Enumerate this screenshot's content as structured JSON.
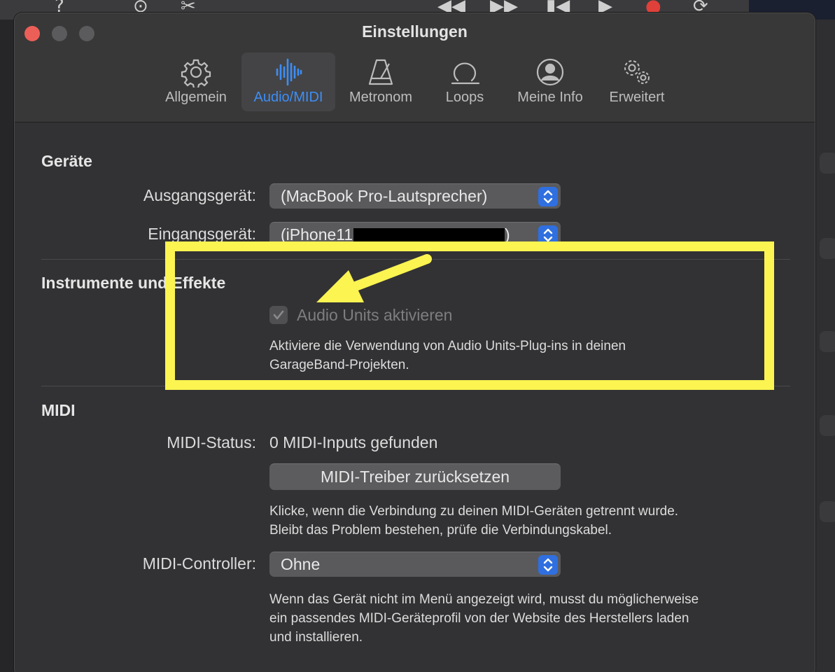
{
  "window": {
    "title": "Einstellungen"
  },
  "tabs": [
    {
      "label": "Allgemein",
      "icon": "gear-icon",
      "active": false
    },
    {
      "label": "Audio/MIDI",
      "icon": "waveform-icon",
      "active": true
    },
    {
      "label": "Metronom",
      "icon": "metronome-icon",
      "active": false
    },
    {
      "label": "Loops",
      "icon": "loop-icon",
      "active": false
    },
    {
      "label": "Meine Info",
      "icon": "person-circle-icon",
      "active": false
    },
    {
      "label": "Erweitert",
      "icon": "gears-icon",
      "active": false
    }
  ],
  "devices": {
    "title": "Geräte",
    "output_label": "Ausgangsgerät:",
    "output_value": "(MacBook Pro-Lautsprecher)",
    "input_label": "Eingangsgerät:",
    "input_value": "(iPhone11",
    "input_value_end": ")"
  },
  "instruments": {
    "title": "Instrumente und Effekte",
    "audio_units_label": "Audio Units aktivieren",
    "audio_units_checked": true,
    "audio_units_desc_1": "Aktiviere die Verwendung von Audio Units-Plug-ins in deinen",
    "audio_units_desc_2": "GarageBand-Projekten."
  },
  "midi": {
    "title": "MIDI",
    "status_label": "MIDI-Status:",
    "status_value": "0 MIDI-Inputs gefunden",
    "reset_button": "MIDI-Treiber zurücksetzen",
    "reset_desc_1": "Klicke, wenn die Verbindung zu deinen MIDI-Geräten getrennt wurde.",
    "reset_desc_2": "Bleibt das Problem bestehen, prüfe die Verbindungskabel.",
    "controller_label": "MIDI-Controller:",
    "controller_value": "Ohne",
    "controller_desc_1": "Wenn das Gerät nicht im Menü angezeigt wird, musst du möglicherweise",
    "controller_desc_2": "ein passendes MIDI-Geräteprofil von der Website des Herstellers laden",
    "controller_desc_3": "und installieren."
  },
  "colors": {
    "accent": "#3d8ef5",
    "annotation": "#fbf451",
    "close": "#ec5f58"
  }
}
